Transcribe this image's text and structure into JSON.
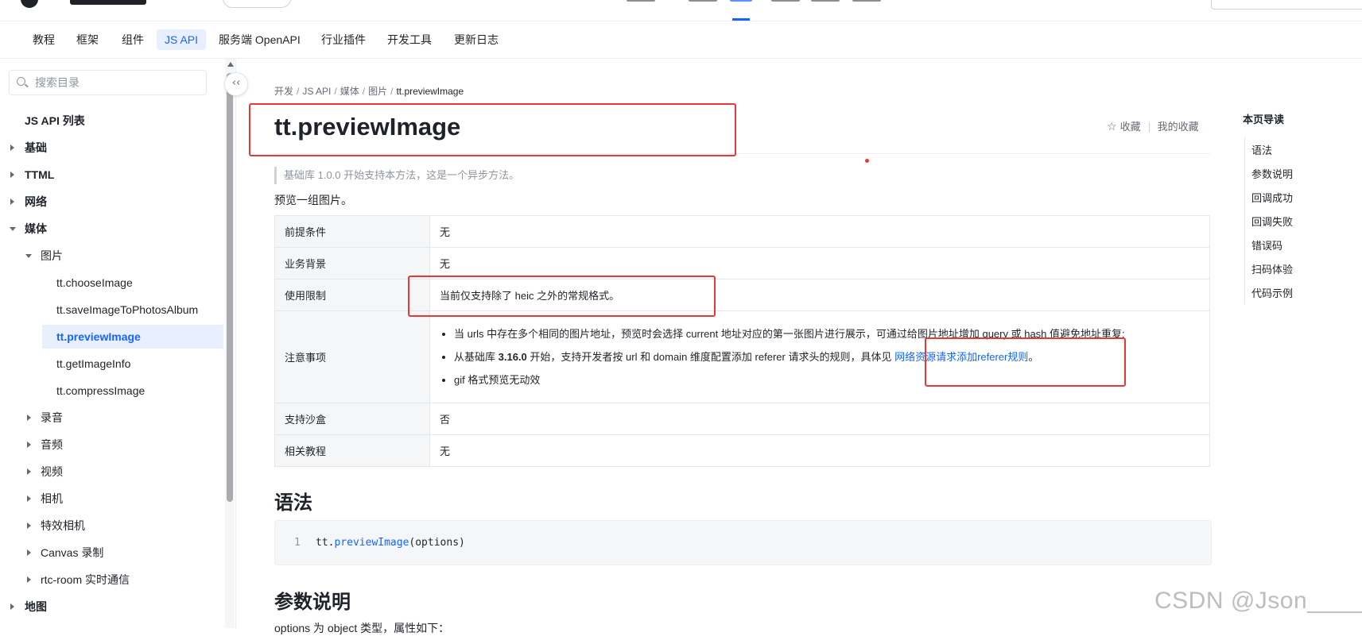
{
  "tabs": [
    {
      "label": "教程",
      "active": false
    },
    {
      "label": "框架",
      "active": false
    },
    {
      "label": "组件",
      "active": false
    },
    {
      "label": "JS API",
      "active": true
    },
    {
      "label": "服务端 OpenAPI",
      "active": false
    },
    {
      "label": "行业插件",
      "active": false
    },
    {
      "label": "开发工具",
      "active": false
    },
    {
      "label": "更新日志",
      "active": false
    }
  ],
  "sidebar": {
    "search_placeholder": "搜索目录",
    "items": [
      {
        "label": "JS API 列表"
      },
      {
        "label": "基础"
      },
      {
        "label": "TTML"
      },
      {
        "label": "网络"
      },
      {
        "label": "媒体"
      },
      {
        "label": "图片"
      },
      {
        "label": "tt.chooseImage"
      },
      {
        "label": "tt.saveImageToPhotosAlbum"
      },
      {
        "label": "tt.previewImage"
      },
      {
        "label": "tt.getImageInfo"
      },
      {
        "label": "tt.compressImage"
      },
      {
        "label": "录音"
      },
      {
        "label": "音频"
      },
      {
        "label": "视频"
      },
      {
        "label": "相机"
      },
      {
        "label": "特效相机"
      },
      {
        "label": "Canvas 录制"
      },
      {
        "label": "rtc-room 实时通信"
      },
      {
        "label": "地图"
      }
    ]
  },
  "breadcrumb": [
    "开发",
    "JS API",
    "媒体",
    "图片",
    "tt.previewImage"
  ],
  "page_title": "tt.previewImage",
  "actions": {
    "favorite": "收藏",
    "my_favorites": "我的收藏"
  },
  "quote": "基础库 1.0.0 开始支持本方法，这是一个异步方法。",
  "intro": "预览一组图片。",
  "info_table": [
    {
      "key": "前提条件",
      "value": "无"
    },
    {
      "key": "业务背景",
      "value": "无"
    },
    {
      "key": "使用限制",
      "value": "当前仅支持除了 heic 之外的常规格式。"
    },
    {
      "key": "注意事项",
      "bullets": [
        "当 urls 中存在多个相同的图片地址，预览时会选择 current 地址对应的第一张图片进行展示，可通过给图片地址增加 query 或 hash 值避免地址重复;",
        {
          "pre": "从基础库 ",
          "bold": "3.16.0",
          "mid": " 开始，支持开发者按 url 和 domain 维度配置添加 referer 请求头的规则，具体见 ",
          "link": "网络资源请求添加referer规则",
          "post": "。"
        },
        "gif 格式预览无动效"
      ]
    },
    {
      "key": "支持沙盒",
      "value": "否"
    },
    {
      "key": "相关教程",
      "value": "无"
    }
  ],
  "section_syntax": "语法",
  "code": {
    "line_no": "1",
    "obj": "tt.",
    "fn": "previewImage",
    "args": "(options)"
  },
  "section_params": "参数说明",
  "params_intro": "options 为 object 类型，属性如下：",
  "toc": {
    "title": "本页导读",
    "items": [
      "语法",
      "参数说明",
      "回调成功",
      "回调失败",
      "错误码",
      "扫码体验",
      "代码示例"
    ]
  },
  "watermark": "CSDN @Json_____",
  "colors": {
    "accent": "#1664ff",
    "annotation_red": "#e53935"
  }
}
